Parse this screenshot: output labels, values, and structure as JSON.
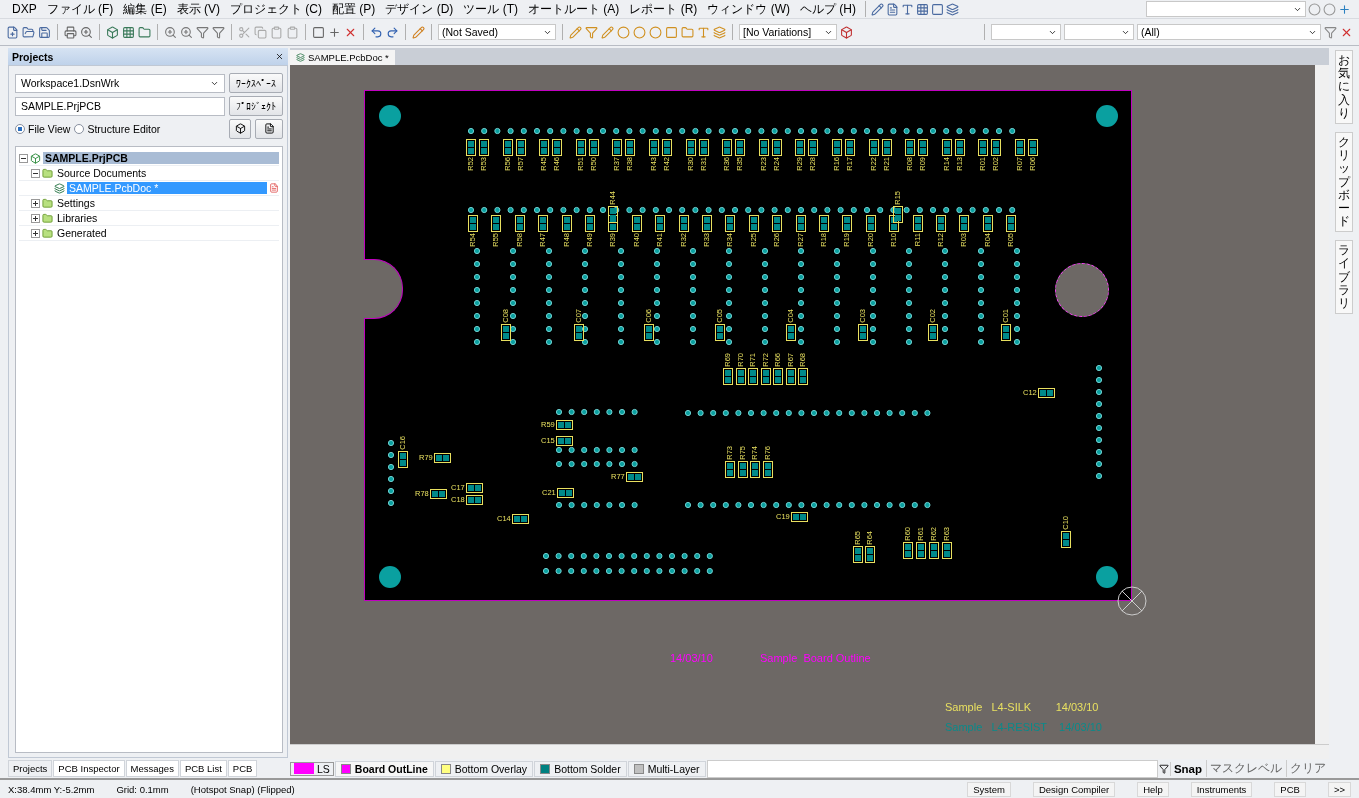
{
  "menu_bar": {
    "items": [
      "DXP",
      "ファイル (F)",
      "編集 (E)",
      "表示 (V)",
      "プロジェクト (C)",
      "配置 (P)",
      "デザイン (D)",
      "ツール (T)",
      "オートルート (A)",
      "レポート (R)",
      "ウィンドウ (W)",
      "ヘルプ (H)"
    ]
  },
  "toolbar": {
    "document_state": "(Not Saved)",
    "variations": "[No Variations]",
    "filter": "(All)"
  },
  "projects_panel": {
    "title": "Projects",
    "workspace": "Workspace1.DsnWrk",
    "workspace_button": "ﾜｰｸｽﾍﾟｰｽ",
    "project": "SAMPLE.PrjPCB",
    "project_button": "ﾌﾟﾛｼﾞｪｸﾄ",
    "views": [
      {
        "label": "File View",
        "selected": true
      },
      {
        "label": "Structure Editor",
        "selected": false
      }
    ],
    "tree": [
      {
        "label": "SAMPLE.PrjPCB",
        "kind": "project",
        "selected": false,
        "expanded": true,
        "children": [
          {
            "label": "Source Documents",
            "kind": "folder",
            "selected": false,
            "expanded": true,
            "children": [
              {
                "label": "SAMPLE.PcbDoc *",
                "kind": "document",
                "selected": true
              }
            ]
          },
          {
            "label": "Settings",
            "kind": "folder",
            "selected": false,
            "expanded": false
          },
          {
            "label": "Libraries",
            "kind": "folder",
            "selected": false,
            "expanded": false
          },
          {
            "label": "Generated",
            "kind": "folder",
            "selected": false,
            "expanded": false
          }
        ]
      }
    ],
    "tabs": [
      {
        "label": "Projects",
        "selected": true
      },
      {
        "label": "PCB Inspector",
        "selected": false
      },
      {
        "label": "Messages",
        "selected": false
      },
      {
        "label": "PCB List",
        "selected": false
      },
      {
        "label": "PCB",
        "selected": false
      }
    ]
  },
  "document_tab": {
    "label": "SAMPLE.PcbDoc *"
  },
  "board": {
    "top_row": [
      "R52",
      "R53",
      "R56",
      "R57",
      "R45",
      "R46",
      "R51",
      "R50",
      "R37",
      "R38",
      "R43",
      "R42",
      "R30",
      "R31",
      "R36",
      "R35",
      "R23",
      "R24",
      "R29",
      "R28",
      "R16",
      "R17",
      "R22",
      "R21",
      "R08",
      "R09",
      "R14",
      "R13",
      "R01",
      "R02",
      "R07",
      "R06"
    ],
    "second_row": [
      "R54",
      "R55",
      "R58",
      "R47",
      "R48",
      "R49",
      "R39",
      "R40",
      "R41",
      "R32",
      "R33",
      "R34",
      "R25",
      "R26",
      "R27",
      "R18",
      "R19",
      "R20",
      "R10",
      "R11",
      "R12",
      "R03",
      "R04",
      "R05"
    ],
    "raised": [
      "R44",
      "R15"
    ],
    "capacitor_row": [
      "C08",
      "C07",
      "C06",
      "C05",
      "C04",
      "C03",
      "C02",
      "C01"
    ],
    "upper_block": [
      "R69",
      "R70",
      "R71",
      "R72",
      "R66",
      "R67",
      "R68"
    ],
    "lower_block": [
      "R73",
      "R75",
      "R74",
      "R76"
    ],
    "parts": [
      {
        "label": "C12",
        "kind": "horizontal"
      },
      {
        "label": "R59",
        "kind": "horizontal"
      },
      {
        "label": "C15",
        "kind": "horizontal"
      },
      {
        "label": "C16",
        "kind": "vertical"
      },
      {
        "label": "R79",
        "kind": "horizontal"
      },
      {
        "label": "C17",
        "kind": "horizontal"
      },
      {
        "label": "C18",
        "kind": "horizontal"
      },
      {
        "label": "R78",
        "kind": "horizontal"
      },
      {
        "label": "C21",
        "kind": "horizontal"
      },
      {
        "label": "R77",
        "kind": "horizontal"
      },
      {
        "label": "C14",
        "kind": "horizontal"
      },
      {
        "label": "C19",
        "kind": "horizontal"
      },
      {
        "label": "C10",
        "kind": "vertical"
      },
      {
        "label": "R65",
        "kind": "vertical"
      },
      {
        "label": "R64",
        "kind": "vertical"
      }
    ],
    "bottom_block": [
      "R60",
      "R61",
      "R62",
      "R63"
    ]
  },
  "canvas_text": [
    {
      "text": "14/03/10",
      "color": "#ff00ff"
    },
    {
      "text": "Sample  Board Outline",
      "color": "#ff00ff"
    },
    {
      "text": "Sample   L4-SILK        14/03/10",
      "color": "#e8e060"
    },
    {
      "text": "Sample   L4-RESIST    14/03/10",
      "color": "#0a8a8a"
    }
  ],
  "side_tabs": [
    "お気に入り",
    "クリップボード",
    "ライブラリ"
  ],
  "layer_tabs": {
    "current": "LS",
    "layers": [
      {
        "label": "Board OutLine",
        "color": "#ff00ff",
        "selected": true
      },
      {
        "label": "Bottom Overlay",
        "color": "#ffff80",
        "selected": false
      },
      {
        "label": "Bottom Solder",
        "color": "#008080",
        "selected": false
      },
      {
        "label": "Multi-Layer",
        "color": "#c0c0c0",
        "selected": false
      }
    ]
  },
  "snap_panel": [
    "Snap",
    "マスクレベル",
    "クリア"
  ],
  "status_bar": {
    "coordinates": "X:38.4mm Y:-5.2mm",
    "grid": "Grid: 0.1mm",
    "mode": "(Hotspot Snap) (Flipped)"
  },
  "panel_buttons": [
    "System",
    "Design Compiler",
    "Help",
    "Instruments",
    "PCB",
    ">>"
  ]
}
